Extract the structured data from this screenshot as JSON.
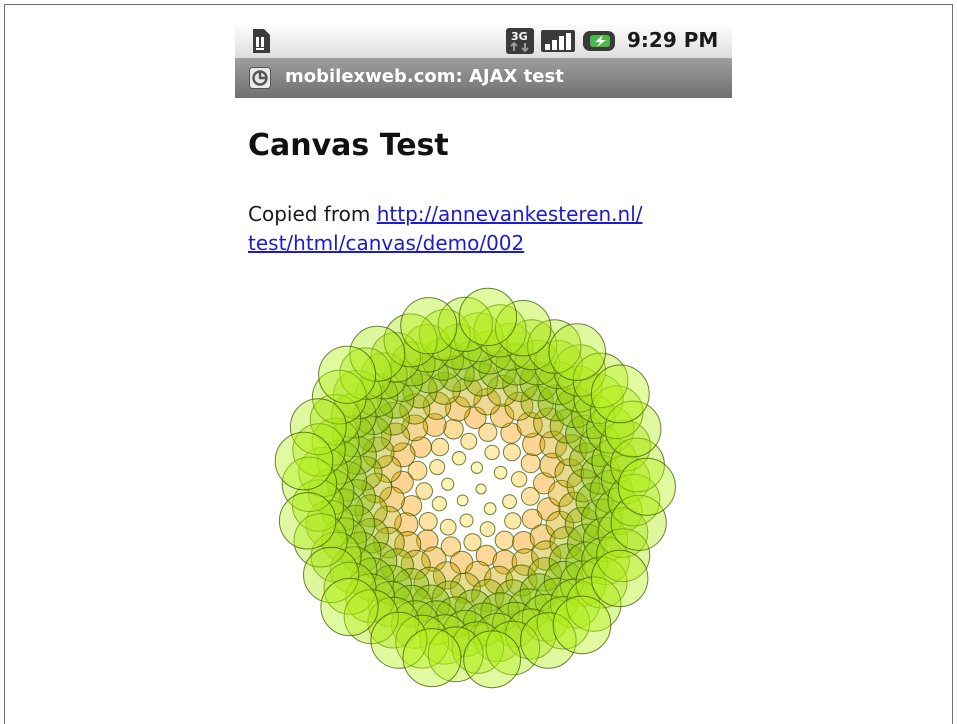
{
  "status_bar": {
    "time": "9:29 PM",
    "network_label": "3G",
    "icons": [
      "sim-card-icon",
      "3g-icon",
      "signal-strength-icon",
      "battery-icon"
    ]
  },
  "browser": {
    "title": "mobilexweb.com: AJAX test",
    "favicon": "globe-icon"
  },
  "page": {
    "heading": "Canvas Test",
    "intro_text": "Copied from ",
    "link_line1": "http://annevankesteren.nl/",
    "link_line2": "test/html/canvas/demo/002"
  },
  "colors": {
    "link": "#1c1ccc",
    "title_bar": "#8a8a8a",
    "circle_outer": "#b6f01e",
    "circle_inner": "#ff9d00",
    "circle_stroke": "#3c5a00"
  }
}
